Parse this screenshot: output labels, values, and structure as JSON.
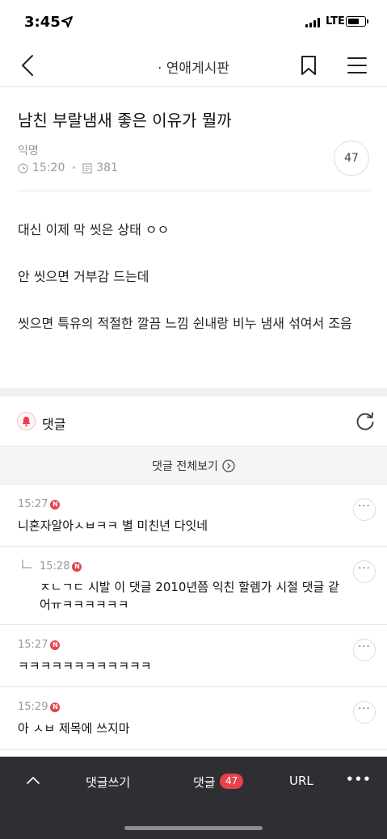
{
  "status_bar": {
    "time": "3:45",
    "network": "LTE"
  },
  "nav": {
    "title": "· 연애게시판"
  },
  "post": {
    "title": "남친 부랄냄새 좋은 이유가 뭘까",
    "author": "익명",
    "time": "15:20",
    "views": "381",
    "comment_count": "47",
    "paragraphs": [
      "대신 이제 막 씻은 상태 ㅇㅇ",
      "안 씻으면 거부감 드는데",
      "씻으면 특유의 적절한 깔끔 느낌 쉰내랑 비누 냄새 섞여서 조음"
    ]
  },
  "comments_section": {
    "header": "댓글",
    "see_all": "댓글 전체보기",
    "items": [
      {
        "time": "15:27",
        "badge": "N",
        "text": "니혼자알아ㅅㅂㅋㅋ 별 미친년 다잇네",
        "reply": false
      },
      {
        "time": "15:28",
        "badge": "N",
        "text": "ㅈㄴㄱㄷ 시발 이 댓글 2010년쯤 익친 할렘가 시절 댓글 같어ㅠㅋㅋㅋㅋㅋㅋ",
        "reply": true
      },
      {
        "time": "15:27",
        "badge": "N",
        "text": "ㅋㅋㅋㅋㅋㅋㅋㅋㅋㅋㅋㅋ",
        "reply": false
      },
      {
        "time": "15:29",
        "badge": "N",
        "text": "아 ㅅㅂ 제목에 쓰지마",
        "reply": false
      }
    ],
    "more_label": "···"
  },
  "toolbar": {
    "write_label": "댓글쓰기",
    "comments_label": "댓글",
    "comments_badge": "47",
    "url_label": "URL",
    "more_label": "•••"
  },
  "colors": {
    "accent": "#e8434a",
    "toolbar_bg": "#2f2f33"
  }
}
